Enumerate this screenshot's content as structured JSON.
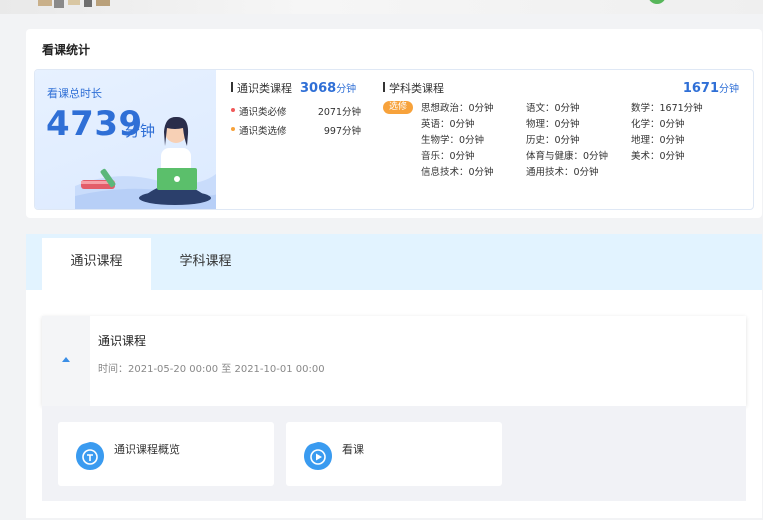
{
  "stats": {
    "title": "看课统计",
    "total_label": "看课总时长",
    "total_value": "4739",
    "total_unit": "分钟",
    "general": {
      "label": "通识类课程",
      "total": "3068",
      "unit": "分钟",
      "rows": [
        {
          "label": "通识类必修",
          "value": "2071分钟",
          "dot_color": "#f05a5a"
        },
        {
          "label": "通识类选修",
          "value": "997分钟",
          "dot_color": "#f7a23b"
        }
      ]
    },
    "subject": {
      "label": "学科类课程",
      "total": "1671",
      "unit": "分钟",
      "tag": "选修",
      "items": [
        "思想政治：0分钟",
        "语文：0分钟",
        "数学：1671分钟",
        "英语：0分钟",
        "物理：0分钟",
        "化学：0分钟",
        "生物学：0分钟",
        "历史：0分钟",
        "地理：0分钟",
        "音乐：0分钟",
        "体育与健康：0分钟",
        "美术：0分钟",
        "信息技术：0分钟",
        "通用技术：0分钟",
        ""
      ]
    }
  },
  "tabs": [
    {
      "label": "通识课程",
      "active": true
    },
    {
      "label": "学科课程",
      "active": false
    }
  ],
  "course": {
    "name": "通识课程",
    "time": "时间：2021-05-20 00:00 至 2021-10-01 00:00"
  },
  "actions": [
    {
      "label": "通识课程概览",
      "icon": "compass-icon"
    },
    {
      "label": "看课",
      "icon": "play-icon"
    }
  ],
  "colors": {
    "accent": "#2f6fd6",
    "tag": "#f7a23b",
    "tab_bar": "#e2f3ff",
    "icon_blue": "#3a9bf0"
  }
}
